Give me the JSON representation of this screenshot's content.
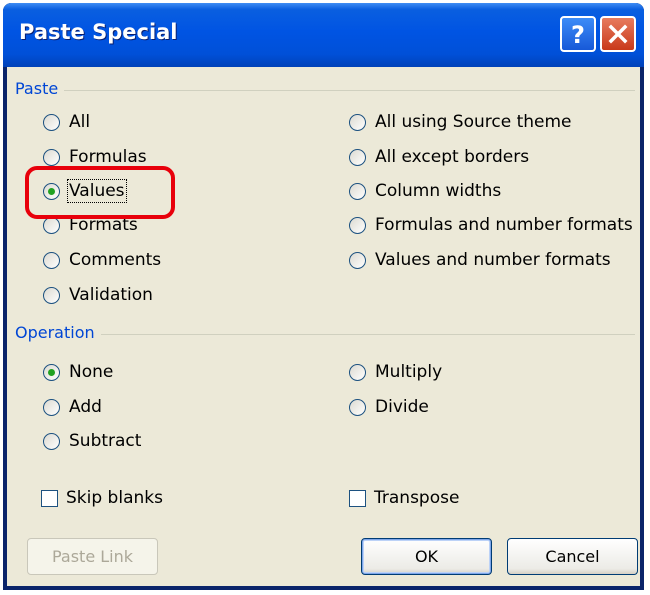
{
  "window": {
    "title": "Paste Special",
    "help_symbol": "?",
    "close_symbol": "✕"
  },
  "paste": {
    "group_label": "Paste",
    "options_left": [
      "All",
      "Formulas",
      "Values",
      "Formats",
      "Comments",
      "Validation"
    ],
    "options_right": [
      "All using Source theme",
      "All except borders",
      "Column widths",
      "Formulas and number formats",
      "Values and number formats"
    ],
    "selected": "Values"
  },
  "operation": {
    "group_label": "Operation",
    "options_left": [
      "None",
      "Add",
      "Subtract"
    ],
    "options_right": [
      "Multiply",
      "Divide"
    ],
    "selected": "None"
  },
  "checkboxes": {
    "skip_blanks": {
      "label": "Skip blanks",
      "checked": false
    },
    "transpose": {
      "label": "Transpose",
      "checked": false
    }
  },
  "buttons": {
    "paste_link": "Paste Link",
    "ok": "OK",
    "cancel": "Cancel"
  },
  "annotation": {
    "highlight_color": "#e8000b",
    "highlighted_option": "Values"
  },
  "colors": {
    "titlebar": "#0054e3",
    "dialog_bg": "#ece9d8",
    "group_label": "#0046d5",
    "radio_selected": "#21a121"
  }
}
